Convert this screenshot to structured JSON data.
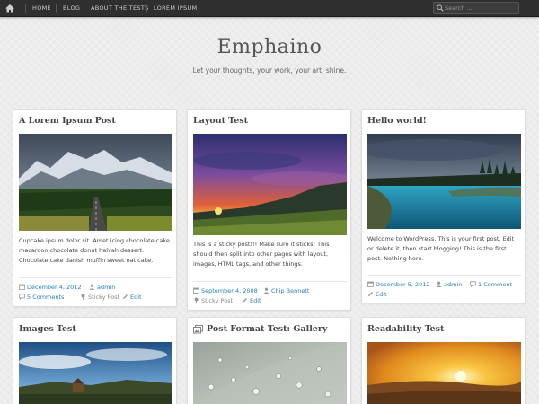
{
  "nav": {
    "items": [
      "HOME",
      "BLOG",
      "ABOUT THE TESTS",
      "LOREM IPSUM"
    ],
    "search_placeholder": "Search ..."
  },
  "site": {
    "title": "Emphaino",
    "tagline": "Let your thoughts, your work, your art, shine."
  },
  "posts": [
    {
      "title": "A Lorem Ipsum Post",
      "excerpt": "Cupcake ipsum dolor sit. Amet icing chocolate cake macaroon chocolate donut halvah dessert. Chocolate cake danish muffin sweet oat cake.",
      "date": "December 4, 2012",
      "author": "admin",
      "comments": "5 Comments",
      "sticky": "Sticky Post",
      "edit": "Edit"
    },
    {
      "title": "Layout Test",
      "excerpt": "This is a sticky post!!! Make sure it sticks! This should then split into other pages with layout, images, HTML tags, and other things.",
      "date": "September 4, 2008",
      "author": "Chip Bennett",
      "sticky": "Sticky Post",
      "edit": "Edit"
    },
    {
      "title": "Hello world!",
      "excerpt": "Welcome to WordPress. This is your first post. Edit or delete it, then start blogging! This is the first post. Nothing here.",
      "date": "December 5, 2012",
      "author": "admin",
      "comments": "1 Comment",
      "edit": "Edit"
    },
    {
      "title": "Images Test"
    },
    {
      "title": "Post Format Test: Gallery"
    },
    {
      "title": "Readability Test"
    }
  ],
  "colors": {
    "nav_bg": "#2f2f2f",
    "link": "#2a7db6",
    "page_bg": "#ececec"
  }
}
